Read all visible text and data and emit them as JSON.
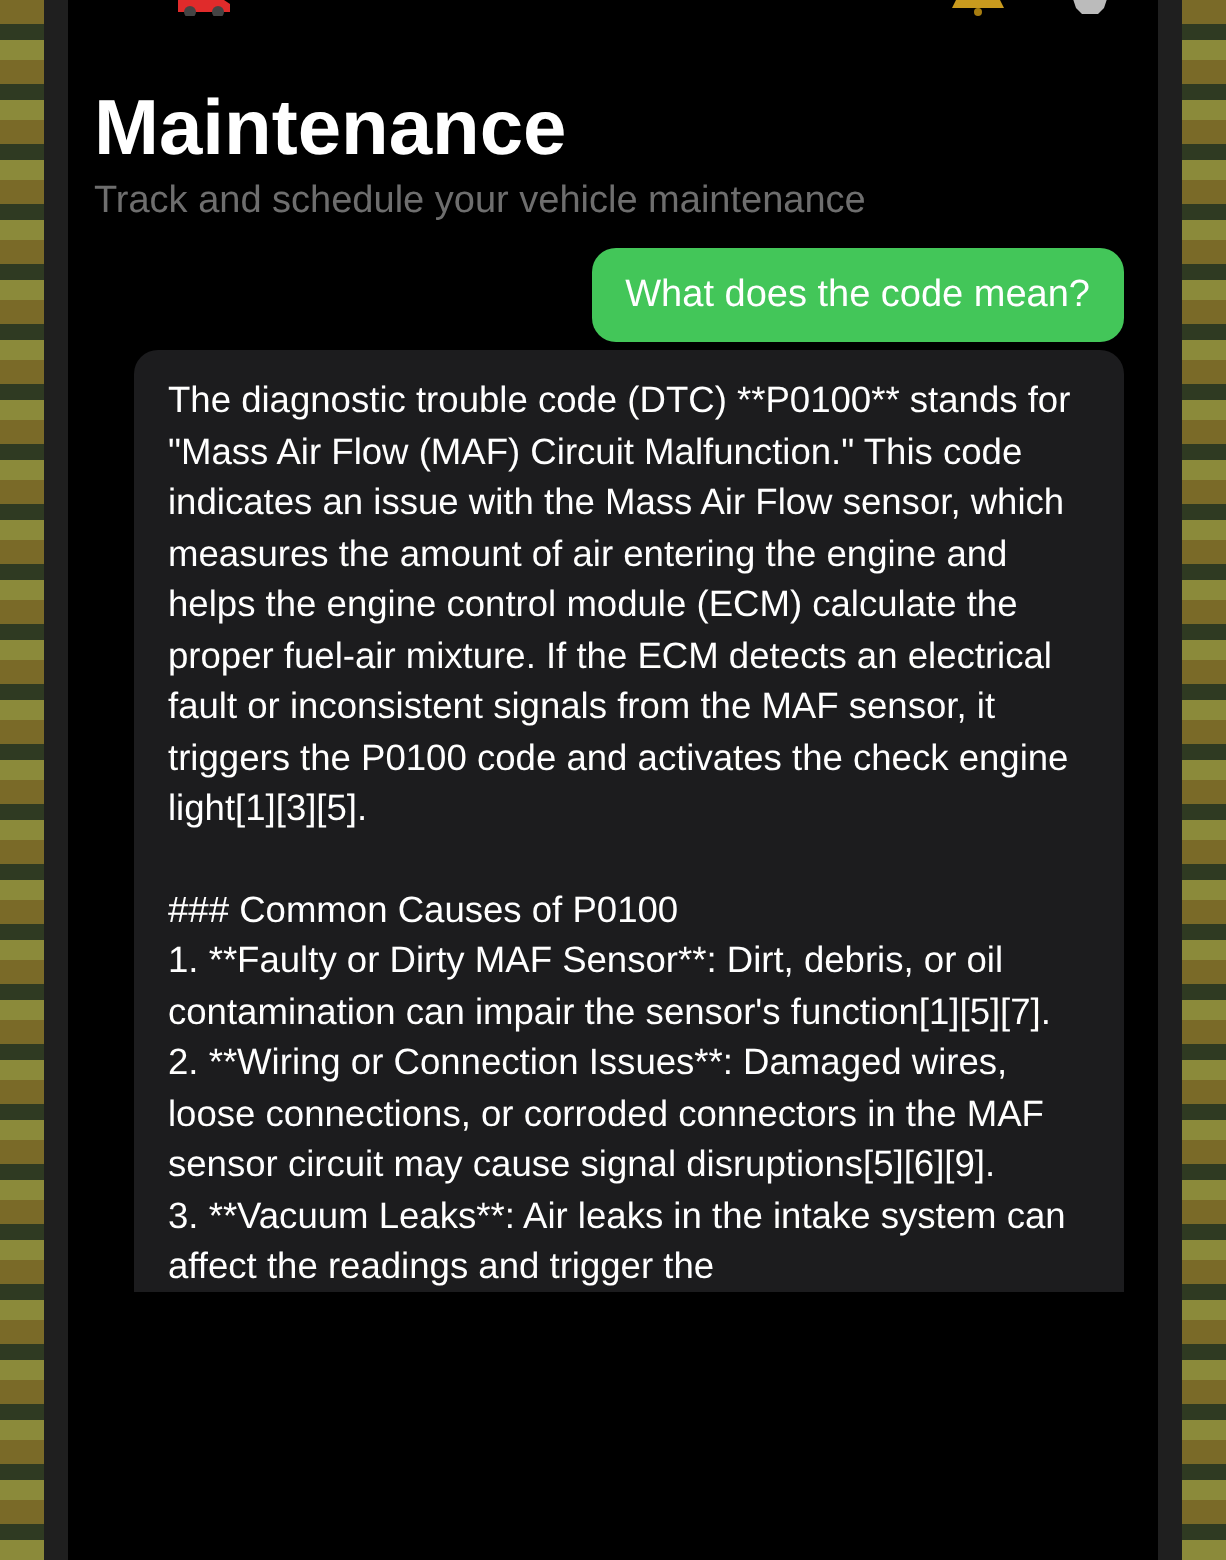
{
  "page": {
    "title": "Maintenance",
    "subtitle": "Track and schedule your vehicle maintenance"
  },
  "messages": [
    {
      "kind": "user",
      "paragraphs": [
        "What does the code mean?"
      ]
    },
    {
      "kind": "assistant",
      "paragraphs": [
        "The diagnostic trouble code (DTC) **P0100** stands for \"Mass Air Flow (MAF) Circuit Malfunction.\" This code indicates an issue with the Mass Air Flow sensor, which measures the amount of air entering the engine and helps the engine control module (ECM) calculate the proper fuel-air mixture. If the ECM detects an electrical fault or inconsistent signals from the MAF sensor, it triggers the P0100 code and activates the check engine light[1][3][5].",
        "### Common Causes of P0100\n1. **Faulty or Dirty MAF Sensor**: Dirt, debris, or oil contamination can impair the sensor's function[1][5][7].\n2. **Wiring or Connection Issues**: Damaged wires, loose connections, or corroded connectors in the MAF sensor circuit may cause signal disruptions[5][6][9].\n3. **Vacuum Leaks**: Air leaks in the intake system can affect the readings and trigger the"
      ]
    }
  ]
}
